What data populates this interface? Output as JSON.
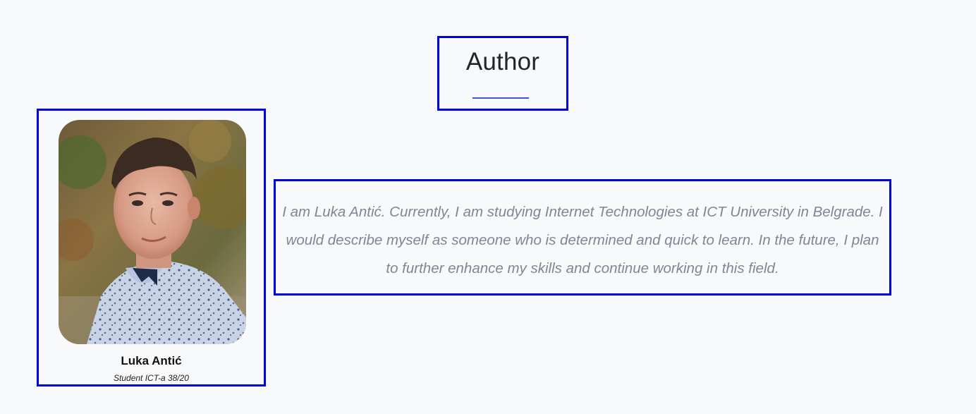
{
  "section": {
    "title": "Author"
  },
  "author": {
    "name": "Luka Antić",
    "role": "Student ICT-a 38/20",
    "photo_alt": "Luka Antić",
    "bio": "I am Luka Antić. Currently, I am studying Internet Technologies at ICT University in Belgrade. I would describe myself as someone who is determined and quick to learn. In the future, I plan to further enhance my skills and continue working in this field."
  },
  "colors": {
    "page_background": "#f8f9fa",
    "box_border": "#0000d8",
    "title_underline": "#3f51d8",
    "bio_text": "#7d8796"
  }
}
